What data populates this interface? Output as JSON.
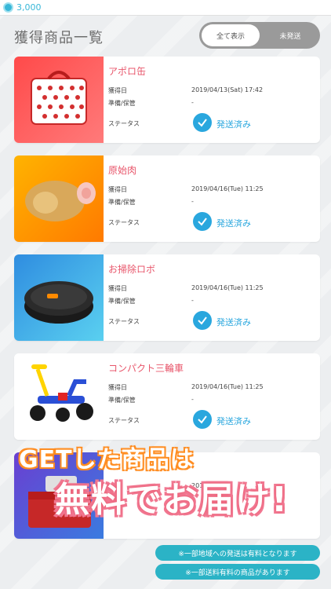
{
  "topbar": {
    "coins": "3,000"
  },
  "header": {
    "title": "獲得商品一覧",
    "toggle_all": "全て表示",
    "toggle_unsent": "未発送"
  },
  "labels": {
    "obtained": "獲得日",
    "prep": "準備/保管",
    "status": "ステータス"
  },
  "items": [
    {
      "name": "アポロ缶",
      "date": "2019/04/13(Sat) 17:42",
      "prep": "-",
      "status": "発送済み"
    },
    {
      "name": "原始肉",
      "date": "2019/04/16(Tue) 11:25",
      "prep": "-",
      "status": "発送済み"
    },
    {
      "name": "お掃除ロボ",
      "date": "2019/04/16(Tue) 11:25",
      "prep": "-",
      "status": "発送済み"
    },
    {
      "name": "コンパクト三輪車",
      "date": "2019/04/16(Tue) 11:25",
      "prep": "-",
      "status": "発送済み"
    },
    {
      "name": "",
      "date": "2019/0",
      "prep": "",
      "status": ""
    }
  ],
  "promo": {
    "line1": "GETした商品は",
    "line2": "無料でお届け!",
    "note1": "※一部地域への発送は有料となります",
    "note2": "※一部送料有料の商品があります"
  },
  "colors": {
    "accent": "#2aa7de",
    "name": "#e8566b",
    "coin": "#38b7d8"
  }
}
